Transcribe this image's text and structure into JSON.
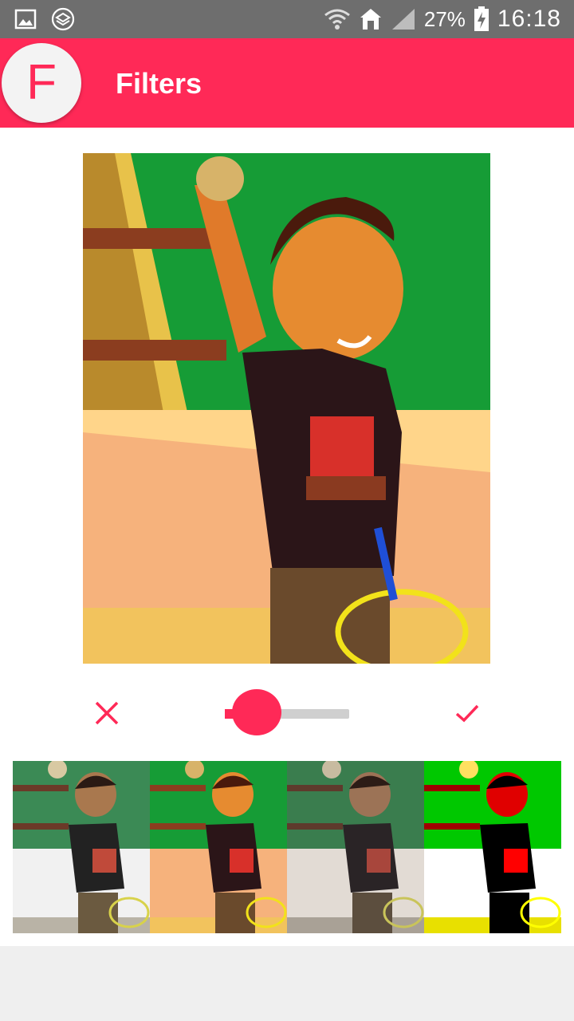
{
  "status_bar": {
    "battery_percent": "27%",
    "time": "16:18",
    "icons": [
      "gallery-icon",
      "layers-icon",
      "wifi-icon",
      "home-icon",
      "signal-icon",
      "battery-charging-icon"
    ]
  },
  "app_bar": {
    "logo_letter": "F",
    "title": "Filters"
  },
  "controls": {
    "cancel_icon": "close-icon",
    "confirm_icon": "check-icon",
    "intensity": 0.1
  },
  "filters": [
    "original",
    "warm",
    "muted",
    "high-contrast"
  ],
  "colors": {
    "accent": "#ff2957",
    "status_bar": "#6e6e6e",
    "track": "#cfcfcf",
    "background": "#efefef"
  }
}
